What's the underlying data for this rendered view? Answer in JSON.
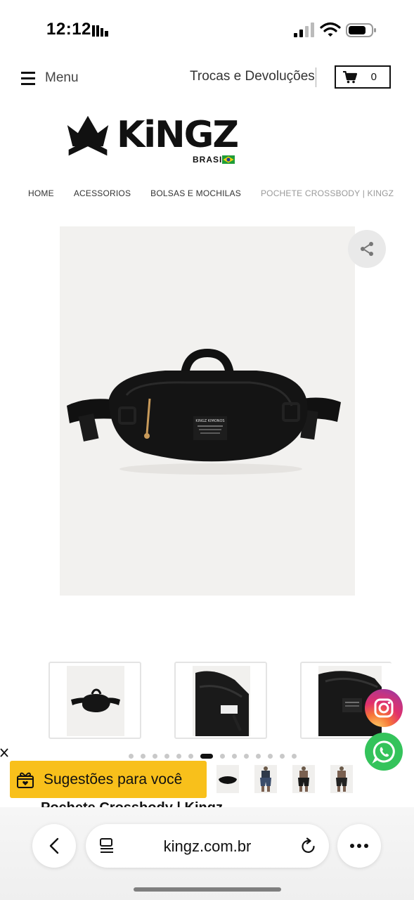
{
  "status_bar": {
    "time": "12:12"
  },
  "header": {
    "menu_label": "Menu",
    "returns_label": "Trocas e Devoluções",
    "cart_count": "0"
  },
  "logo": {
    "brand": "KiNGZ",
    "sub": "BRASIL"
  },
  "breadcrumb": [
    "HOME",
    "ACESSORIOS",
    "BOLSAS E MOCHILAS",
    "POCHETE CROSSBODY | KINGZ"
  ],
  "gallery": {
    "slide_count": 14,
    "active_slide": 7,
    "bag_label": "KINGZ KIMONOS"
  },
  "suggestions": {
    "label": "Sugestões para você"
  },
  "product": {
    "title": "Pochete Crossbody | Kingz"
  },
  "browser": {
    "url": "kingz.com.br"
  },
  "colors": {
    "accent_yellow": "#f8c01b",
    "whatsapp_green": "#34c35b"
  }
}
